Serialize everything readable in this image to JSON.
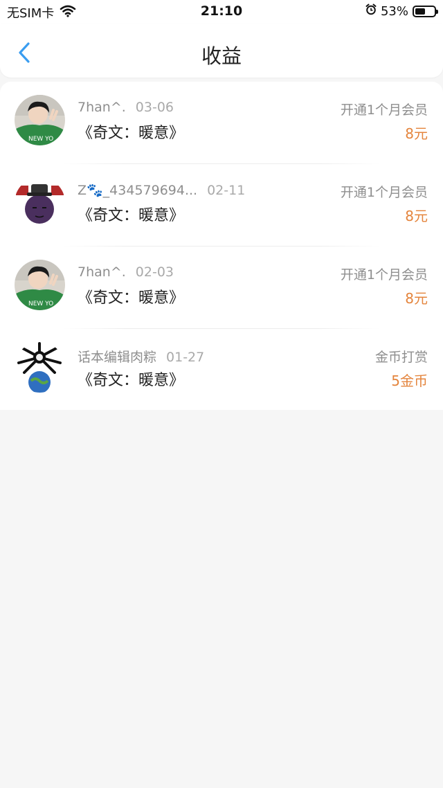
{
  "status_bar": {
    "carrier": "无SIM卡",
    "time": "21:10",
    "battery_text": "53%",
    "battery_level": 0.53
  },
  "nav": {
    "title": "收益"
  },
  "records": [
    {
      "user": "7han^.",
      "date": "03-06",
      "book": "《奇文：暖意》",
      "type": "开通1个月会员",
      "amount": "8元"
    },
    {
      "user": "Z🐾_434579694...",
      "date": "02-11",
      "book": "《奇文：暖意》",
      "type": "开通1个月会员",
      "amount": "8元"
    },
    {
      "user": "7han^.",
      "date": "02-03",
      "book": "《奇文：暖意》",
      "type": "开通1个月会员",
      "amount": "8元"
    },
    {
      "user": "话本编辑肉粽",
      "date": "01-27",
      "book": "《奇文：暖意》",
      "type": "金币打赏",
      "amount": "5金币"
    }
  ],
  "colors": {
    "accent_blue": "#3a9df0",
    "amount_orange": "#e4843c"
  }
}
